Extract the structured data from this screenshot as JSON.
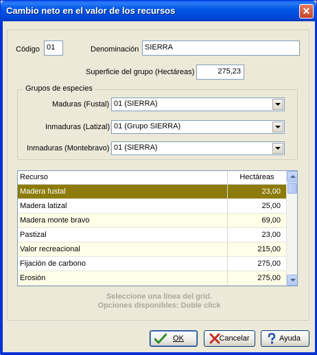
{
  "window": {
    "title": "Cambio neto en el valor de los recursos",
    "close_glyph": "✕"
  },
  "form": {
    "codigo_label": "Código",
    "codigo_value": "01",
    "denominacion_label": "Denominación",
    "denominacion_value": "SIERRA",
    "superficie_label": "Superficie del grupo (Hectáreas)",
    "superficie_value": "275,23"
  },
  "groups": {
    "title": "Grupos de especies",
    "maduras_label": "Maduras (Fustal)",
    "maduras_value": "01 (SIERRA)",
    "inmaduras_latizal_label": "Inmaduras (Latizal)",
    "inmaduras_latizal_value": "01 (Grupo SIERRA)",
    "inmaduras_monte_label": "Inmaduras (Montebravo)",
    "inmaduras_monte_value": "01 (SIERRA)"
  },
  "grid": {
    "col_recurso": "Recurso",
    "col_hectareas": "Hectáreas",
    "rows": [
      {
        "recurso": "Madera fustal",
        "hectareas": "23,00"
      },
      {
        "recurso": "Madera latizal",
        "hectareas": "25,00"
      },
      {
        "recurso": "Madera monte bravo",
        "hectareas": "69,00"
      },
      {
        "recurso": "Pastizal",
        "hectareas": "23,00"
      },
      {
        "recurso": "Valor recreacional",
        "hectareas": "215,00"
      },
      {
        "recurso": "Fijación de carbono",
        "hectareas": "275,00"
      },
      {
        "recurso": "Erosión",
        "hectareas": "275,00"
      }
    ],
    "selected_row": 0
  },
  "hints": {
    "line1": "Seleccione una línea del grid.",
    "line2": "Opciones disponibles: Doble click"
  },
  "buttons": {
    "ok_label": "OK",
    "cancel_label": "Cancelar",
    "help_label": "Ayuda"
  },
  "icons": {
    "ok": "checkmark-icon",
    "cancel": "x-icon",
    "help": "question-icon"
  },
  "colors": {
    "selected_row": "#8C7B0B",
    "alt_row": "#FFFFE8",
    "titlebar": "#0058E6"
  }
}
